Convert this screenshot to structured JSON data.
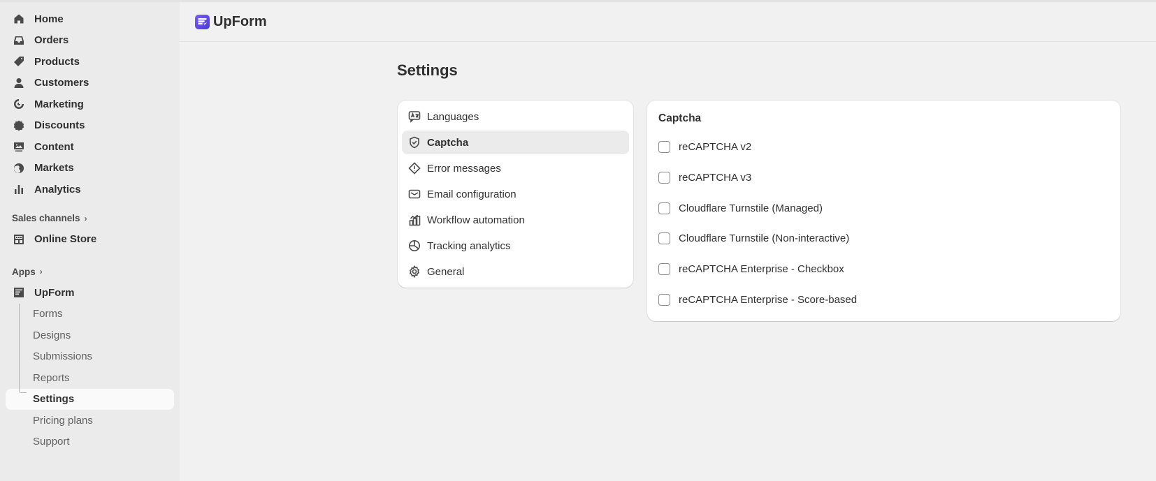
{
  "sidebar": {
    "main_items": [
      {
        "label": "Home",
        "icon": "home-icon"
      },
      {
        "label": "Orders",
        "icon": "inbox-icon"
      },
      {
        "label": "Products",
        "icon": "tag-icon"
      },
      {
        "label": "Customers",
        "icon": "person-icon"
      },
      {
        "label": "Marketing",
        "icon": "target-icon"
      },
      {
        "label": "Discounts",
        "icon": "discount-icon"
      },
      {
        "label": "Content",
        "icon": "image-icon"
      },
      {
        "label": "Markets",
        "icon": "globe-icon"
      },
      {
        "label": "Analytics",
        "icon": "bar-chart-icon"
      }
    ],
    "sales_channels_label": "Sales channels",
    "online_store_label": "Online Store",
    "apps_label": "Apps",
    "app_label": "UpForm",
    "app_sub_items": [
      {
        "label": "Forms"
      },
      {
        "label": "Designs"
      },
      {
        "label": "Submissions"
      },
      {
        "label": "Reports"
      },
      {
        "label": "Settings",
        "active": true
      },
      {
        "label": "Pricing plans"
      },
      {
        "label": "Support"
      }
    ]
  },
  "header": {
    "app_title": "UpForm"
  },
  "page": {
    "title": "Settings"
  },
  "settings_menu": [
    {
      "label": "Languages",
      "icon": "languages-icon"
    },
    {
      "label": "Captcha",
      "icon": "shield-check-icon",
      "active": true
    },
    {
      "label": "Error messages",
      "icon": "alert-diamond-icon"
    },
    {
      "label": "Email configuration",
      "icon": "envelope-icon"
    },
    {
      "label": "Workflow automation",
      "icon": "workflow-icon"
    },
    {
      "label": "Tracking analytics",
      "icon": "analytics-circle-icon"
    },
    {
      "label": "General",
      "icon": "gear-icon"
    }
  ],
  "captcha": {
    "title": "Captcha",
    "options": [
      {
        "label": "reCAPTCHA v2",
        "checked": false
      },
      {
        "label": "reCAPTCHA v3",
        "checked": false
      },
      {
        "label": "Cloudflare Turnstile (Managed)",
        "checked": false
      },
      {
        "label": "Cloudflare Turnstile (Non-interactive)",
        "checked": false
      },
      {
        "label": "reCAPTCHA Enterprise - Checkbox",
        "checked": false
      },
      {
        "label": "reCAPTCHA Enterprise - Score-based",
        "checked": false
      }
    ]
  },
  "colors": {
    "page_bg": "#f1f1f1",
    "sidebar_bg": "#ebebeb",
    "card_bg": "#ffffff",
    "active_menu_bg": "#ebebeb",
    "text": "#303030",
    "brand": "#6b4eff"
  }
}
